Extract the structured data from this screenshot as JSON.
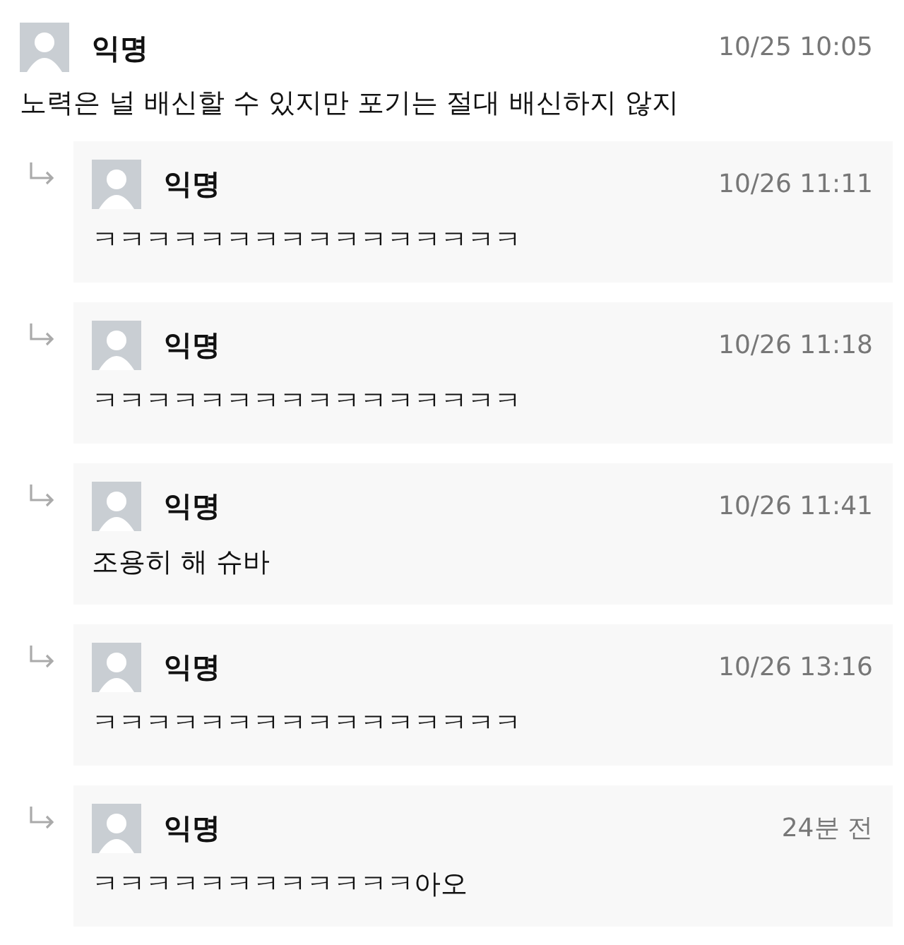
{
  "post": {
    "author": "익명",
    "time": "10/25 10:05",
    "text": "노력은 널 배신할 수 있지만 포기는 절대 배신하지 않지"
  },
  "replies": [
    {
      "author": "익명",
      "time": "10/26 11:11",
      "text": "ㅋㅋㅋㅋㅋㅋㅋㅋㅋㅋㅋㅋㅋㅋㅋㅋ"
    },
    {
      "author": "익명",
      "time": "10/26 11:18",
      "text": "ㅋㅋㅋㅋㅋㅋㅋㅋㅋㅋㅋㅋㅋㅋㅋㅋ"
    },
    {
      "author": "익명",
      "time": "10/26 11:41",
      "text": "조용히 해 슈바"
    },
    {
      "author": "익명",
      "time": "10/26 13:16",
      "text": "ㅋㅋㅋㅋㅋㅋㅋㅋㅋㅋㅋㅋㅋㅋㅋㅋ"
    },
    {
      "author": "익명",
      "time": "24분 전",
      "text": "ㅋㅋㅋㅋㅋㅋㅋㅋㅋㅋㅋㅋ아오"
    }
  ]
}
